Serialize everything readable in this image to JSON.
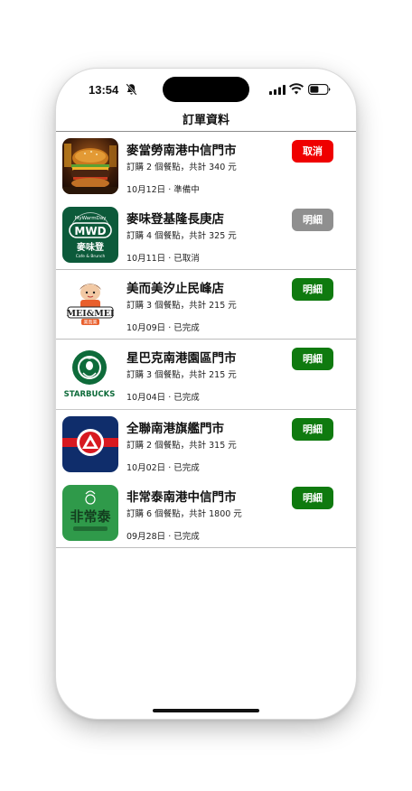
{
  "status": {
    "time": "13:54"
  },
  "nav": {
    "title": "訂單資料"
  },
  "orders": [
    {
      "name": "麥當勞南港中信門市",
      "desc": "訂購 2 個餐點，共計 340 元",
      "date": "10月12日 · 準備中",
      "button": "取消",
      "button_color": "#ef0000",
      "logo": "burger-photo"
    },
    {
      "name": "麥味登基隆長庚店",
      "desc": "訂購 4 個餐點，共計 325 元",
      "date": "10月11日 · 已取消",
      "button": "明細",
      "button_color": "#8f8f8f",
      "logo_text": "MWD",
      "logo_sub": "麥味登",
      "logo_top": "MyWarmDay",
      "logo_bottom": "Cafe & Brunch"
    },
    {
      "name": "美而美汐止民峰店",
      "desc": "訂購 3 個餐點，共計 215 元",
      "date": "10月09日 · 已完成",
      "button": "明細",
      "button_color": "#0f7a0f",
      "logo_text": "MEI&MEI",
      "logo_sub": "美而美"
    },
    {
      "name": "星巴克南港園區門市",
      "desc": "訂購 3 個餐點，共計 215 元",
      "date": "10月04日 · 已完成",
      "button": "明細",
      "button_color": "#0f7a0f",
      "logo_text": "STARBUCKS"
    },
    {
      "name": "全聯南港旗艦門市",
      "desc": "訂購 2 個餐點，共計 315 元",
      "date": "10月02日 · 已完成",
      "button": "明細",
      "button_color": "#0f7a0f",
      "logo": "pxmart-logo"
    },
    {
      "name": "非常泰南港中信門市",
      "desc": "訂購 6 個餐點，共計 1800 元",
      "date": "09月28日 · 已完成",
      "button": "明細",
      "button_color": "#0f7a0f",
      "logo_text": "非常泰"
    }
  ]
}
